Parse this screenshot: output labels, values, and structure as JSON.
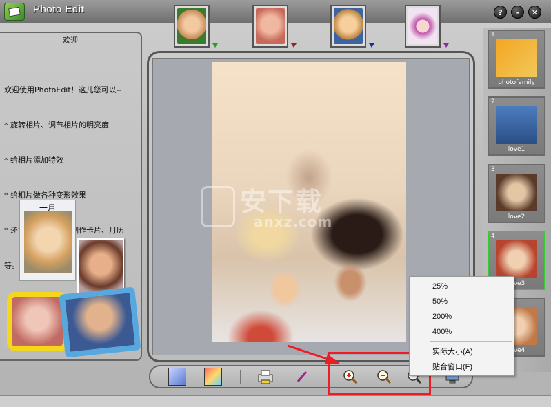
{
  "app": {
    "title": "Photo Edit",
    "window_buttons": {
      "help": "?",
      "minimize": "–",
      "close": "✕"
    }
  },
  "welcome": {
    "header": "欢迎",
    "lines": [
      "欢迎使用PhotoEdit！这儿您可以--",
      "* 旋转相片、调节相片的明亮度",
      "* 给相片添加特效",
      "* 给相片做各种变形效果",
      "* 还能用自己的相片制作卡片、月历",
      "等。"
    ],
    "calendar_month": "一月"
  },
  "watermark": {
    "brand": "安下载",
    "domain": "anxz.com"
  },
  "filmstrip": {
    "items": [
      {
        "num": "1",
        "label": "photofamily"
      },
      {
        "num": "2",
        "label": "love1"
      },
      {
        "num": "3",
        "label": "love2"
      },
      {
        "num": "4",
        "label": "love3"
      },
      {
        "num": "",
        "label": "love4"
      }
    ],
    "selected_index": 3
  },
  "zoom_menu": {
    "items": [
      "25%",
      "50%",
      "200%",
      "400%"
    ],
    "actual_size": "实际大小(A)",
    "fit_window": "贴合窗口(F)"
  },
  "colors": {
    "highlight": "#ee1c25",
    "selected_thumb_border": "#33cc33"
  }
}
